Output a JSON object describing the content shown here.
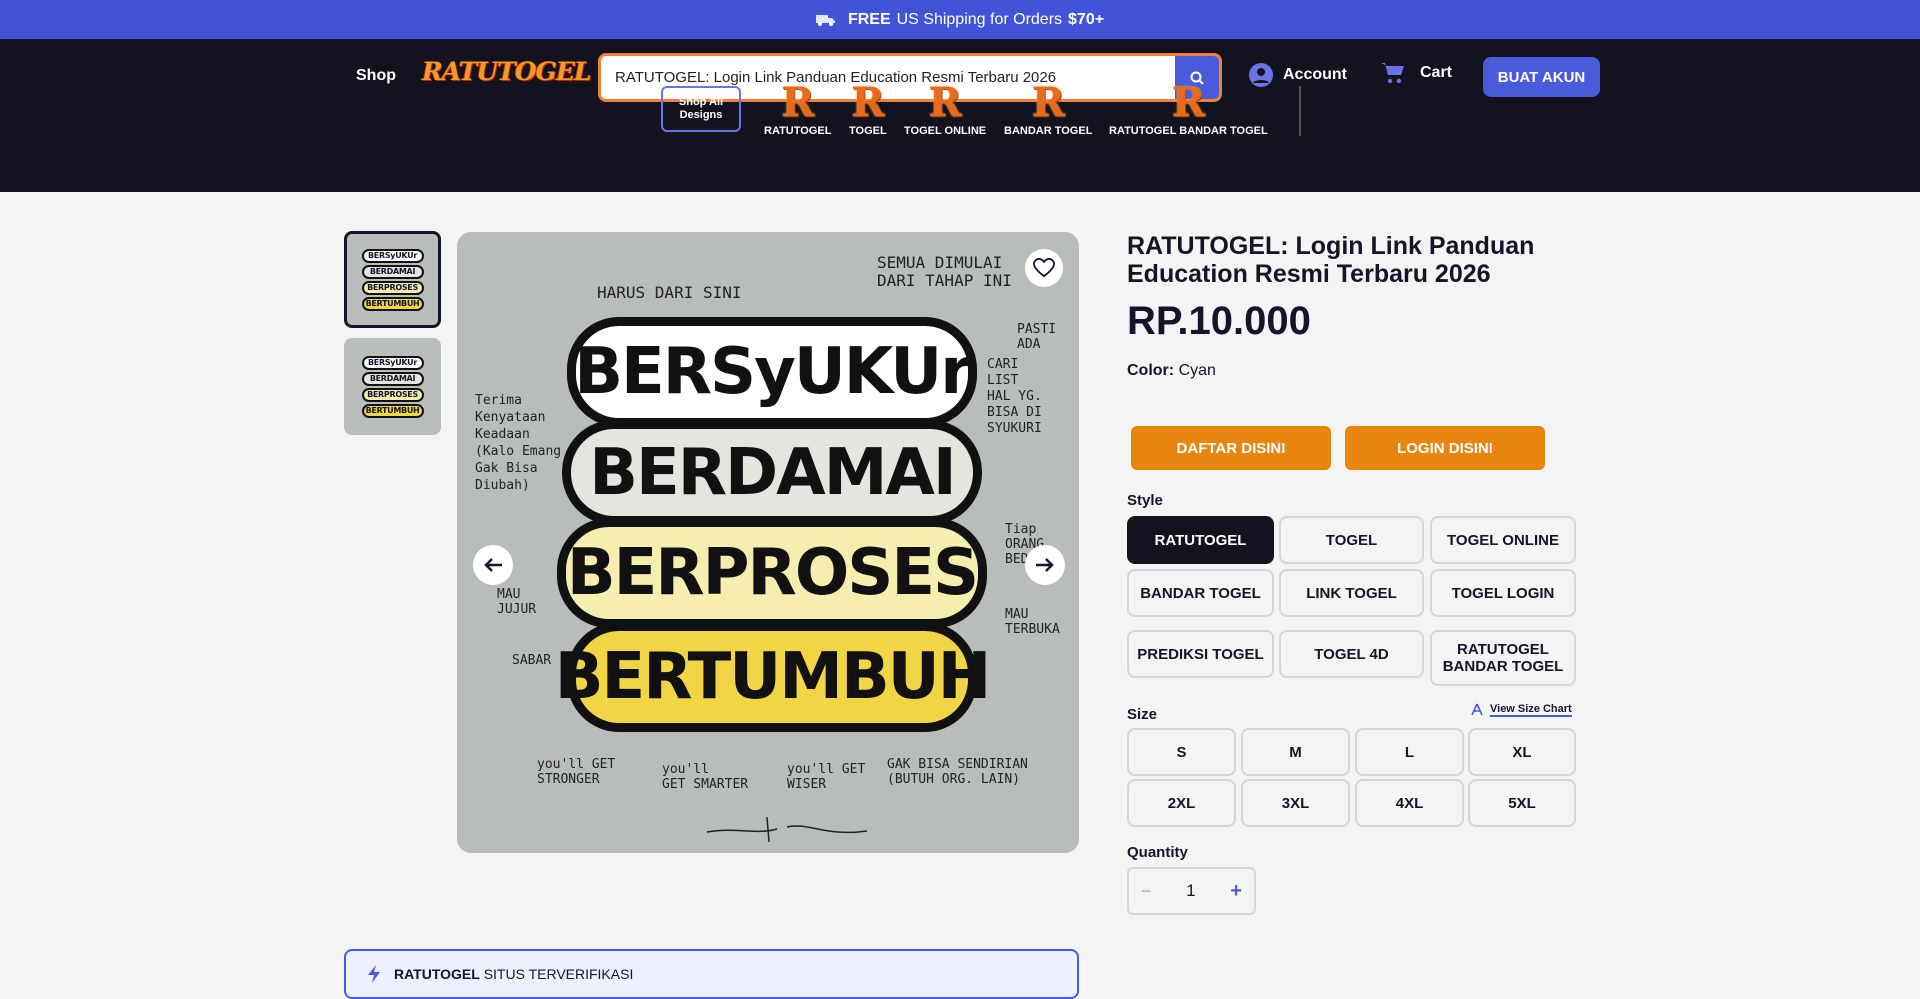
{
  "promo": {
    "free": "FREE",
    "text": "US Shipping for Orders",
    "amount": "$70+"
  },
  "header": {
    "shop_label": "Shop",
    "logo_text": "RATUTOGEL",
    "search_value": "RATUTOGEL: Login Link Panduan Education Resmi Terbaru 2026",
    "account_label": "Account",
    "cart_label": "Cart",
    "buat_label": "BUAT AKUN"
  },
  "nav": {
    "shop_all": "Shop All Designs",
    "categories": [
      {
        "label": "RATUTOGEL",
        "icon_letter": "R"
      },
      {
        "label": "TOGEL",
        "icon_letter": "R"
      },
      {
        "label": "TOGEL ONLINE",
        "icon_letter": "R"
      },
      {
        "label": "BANDAR TOGEL",
        "icon_letter": "R"
      },
      {
        "label": "RATUTOGEL BANDAR TOGEL",
        "icon_letter": "R"
      }
    ]
  },
  "gallery": {
    "words": [
      "BERSyUKUr",
      "BERDAMAI",
      "BERPROSES",
      "BERTUMBUH"
    ],
    "notes": {
      "harus": "HARUS DARI SINI",
      "semua": "SEMUA DIMULAI\nDARI TAHAP INI",
      "pasti": "PASTI\nADA",
      "cari": "CARI\nLIST\nHAL YG.\nBISA DI\nSYUKURI",
      "terima": "Terima\nKenyataan\nKeadaan\n(Kalo Emang\nGak Bisa\nDiubah)",
      "tiap": "Tiap\nORANG\nBEDA",
      "mau_jujur": "MAU\nJUJUR",
      "mau_terbuka": "MAU\nTERBUKA",
      "sabar": "SABAR",
      "stronger": "you'll GET\nSTRONGER",
      "smarter": "you'll\nGET SMARTER",
      "wiser": "you'll GET\nWISER",
      "gak_bisa": "GAK BISA SENDIRIAN\n(BUTUH ORG. LAIN)"
    }
  },
  "product": {
    "title": "RATUTOGEL: Login Link Panduan Education Resmi Terbaru 2026",
    "price": "RP.10.000",
    "color_label": "Color:",
    "color_value": "Cyan",
    "daftar": "DAFTAR DISINI",
    "login": "LOGIN DISINI",
    "style_label": "Style",
    "styles": [
      "RATUTOGEL",
      "TOGEL",
      "TOGEL ONLINE",
      "BANDAR TOGEL",
      "LINK TOGEL",
      "TOGEL LOGIN",
      "PREDIKSI TOGEL",
      "TOGEL 4D",
      "RATUTOGEL BANDAR TOGEL"
    ],
    "selected_style": "RATUTOGEL",
    "size_label": "Size",
    "size_chart": "View Size Chart",
    "sizes": [
      "S",
      "M",
      "L",
      "XL",
      "2XL",
      "3XL",
      "4XL",
      "5XL"
    ],
    "quantity_label": "Quantity",
    "quantity": "1",
    "qty_minus": "−",
    "qty_plus": "+"
  },
  "verified": {
    "brand": "RATUTOGEL",
    "text": "SITUS TERVERIFIKASI"
  },
  "colors": {
    "accent": "#4a5bd9",
    "promo": "#4154d8",
    "dark": "#12131f",
    "orange": "#e8850e"
  }
}
